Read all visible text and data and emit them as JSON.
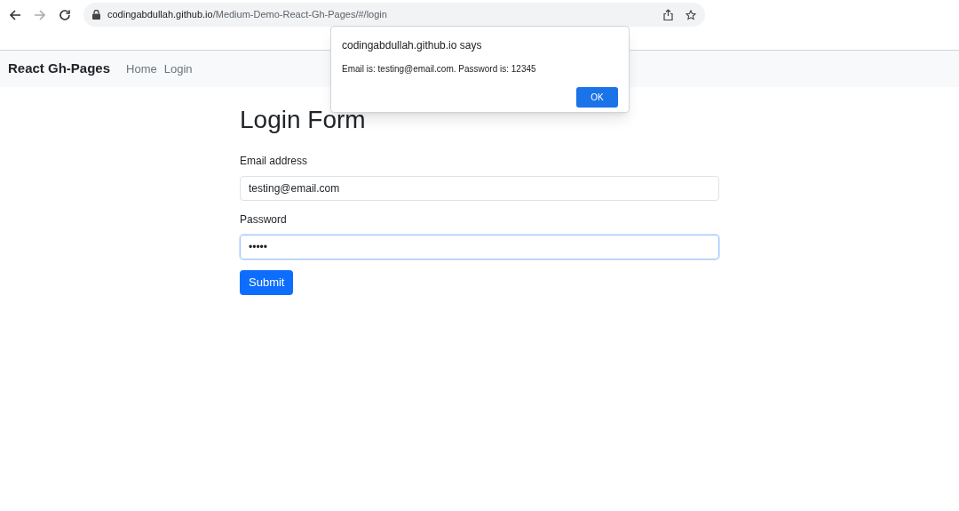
{
  "browser": {
    "url_host": "codingabdullah.github.io",
    "url_path": "/Medium-Demo-React-Gh-Pages/#/login"
  },
  "navbar": {
    "brand": "React Gh-Pages",
    "links": [
      "Home",
      "Login"
    ]
  },
  "form": {
    "title": "Login Form",
    "fields": [
      {
        "label": "Email address",
        "value": "testing@email.com",
        "focused": false
      },
      {
        "label": "Password",
        "value": "•••••",
        "focused": true
      }
    ],
    "submit": "Submit"
  },
  "dialog": {
    "title": "codingabdullah.github.io says",
    "message": "Email is: testing@email.com. Password is: 12345",
    "button": "OK"
  }
}
